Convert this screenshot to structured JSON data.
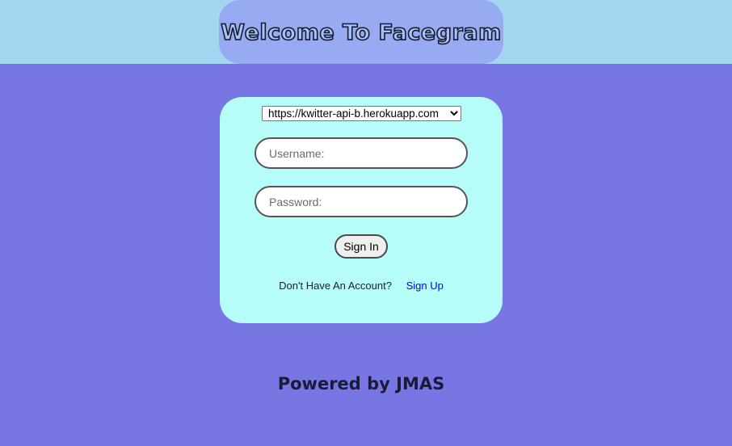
{
  "header": {
    "title": "Welcome To Facegram"
  },
  "login_form": {
    "server_select": {
      "selected": "https://kwitter-api-b.herokuapp.com",
      "options": [
        "https://kwitter-api-b.herokuapp.com"
      ]
    },
    "username": {
      "placeholder": "Username:",
      "value": ""
    },
    "password": {
      "placeholder": "Password:",
      "value": ""
    },
    "sign_in_label": "Sign In",
    "no_account_text": "Don't Have An Account?",
    "sign_up_label": "Sign Up"
  },
  "footer": {
    "text": "Powered by JMAS"
  },
  "colors": {
    "page_background": "#7876e3",
    "header_band": "#a2d6f1",
    "title_pill": "#97aaf2",
    "card_background": "#b6fcf9",
    "link": "#0000ee"
  }
}
